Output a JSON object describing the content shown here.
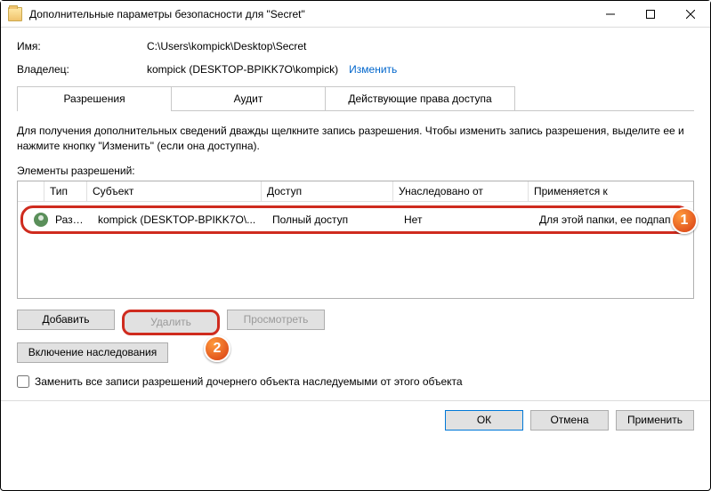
{
  "window": {
    "title": "Дополнительные параметры безопасности для \"Secret\""
  },
  "fields": {
    "name_label": "Имя:",
    "name_value": "C:\\Users\\kompick\\Desktop\\Secret",
    "owner_label": "Владелец:",
    "owner_value": "kompick (DESKTOP-BPIKK7O\\kompick)",
    "change_link": "Изменить"
  },
  "tabs": {
    "perm": "Разрешения",
    "audit": "Аудит",
    "effective": "Действующие права доступа"
  },
  "info": "Для получения дополнительных сведений дважды щелкните запись разрешения. Чтобы изменить запись разрешения, выделите ее и нажмите кнопку \"Изменить\" (если она доступна).",
  "section_label": "Элементы разрешений:",
  "columns": {
    "type": "Тип",
    "subject": "Субъект",
    "access": "Доступ",
    "inherited": "Унаследовано от",
    "applies": "Применяется к"
  },
  "rows": [
    {
      "type": "Разр...",
      "subject": "kompick (DESKTOP-BPIKK7O\\...",
      "access": "Полный доступ",
      "inherited": "Нет",
      "applies": "Для этой папки, ее подпапок ..."
    }
  ],
  "buttons": {
    "add": "Добавить",
    "remove": "Удалить",
    "view": "Просмотреть",
    "inherit": "Включение наследования"
  },
  "checkbox": "Заменить все записи разрешений дочернего объекта наследуемыми от этого объекта",
  "footer": {
    "ok": "ОК",
    "cancel": "Отмена",
    "apply": "Применить"
  },
  "badges": {
    "one": "1",
    "two": "2"
  }
}
